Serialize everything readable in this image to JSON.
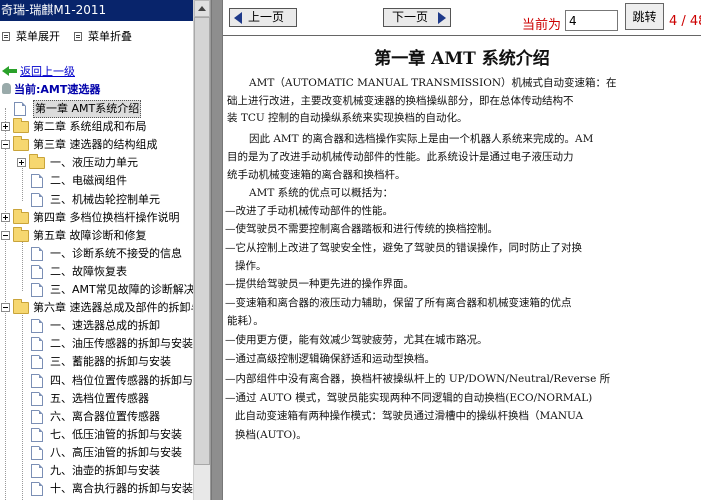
{
  "sidebar": {
    "title": "奇瑞-瑞麒M1-2011",
    "expand_label": "菜单展开",
    "collapse_label": "菜单折叠",
    "back_label": "返回上一级",
    "current_label": "当前:AMT速选器",
    "items": [
      {
        "label": "第一章 AMT系统介绍",
        "type": "doc",
        "level": 1,
        "selected": true
      },
      {
        "label": "第二章 系统组成和布局",
        "type": "folder",
        "level": 0
      },
      {
        "label": "第三章 速选器的结构组成",
        "type": "folder",
        "level": 0,
        "expanded": true
      },
      {
        "label": "一、液压动力单元",
        "type": "folder",
        "level": 1
      },
      {
        "label": "二、电磁阀组件",
        "type": "doc",
        "level": 2
      },
      {
        "label": "三、机械齿轮控制单元",
        "type": "doc",
        "level": 2
      },
      {
        "label": "第四章 多档位换档杆操作说明",
        "type": "folder",
        "level": 0
      },
      {
        "label": "第五章 故障诊断和修复",
        "type": "folder",
        "level": 0,
        "expanded": true
      },
      {
        "label": "一、诊断系统不接受的信息",
        "type": "doc",
        "level": 2
      },
      {
        "label": "二、故障恢复表",
        "type": "doc",
        "level": 2
      },
      {
        "label": "三、AMT常见故障的诊断解决",
        "type": "doc",
        "level": 2
      },
      {
        "label": "第六章 速选器总成及部件的拆卸与",
        "type": "folder",
        "level": 0,
        "expanded": true
      },
      {
        "label": "一、速选器总成的拆卸",
        "type": "doc",
        "level": 2
      },
      {
        "label": "二、油压传感器的拆卸与安装",
        "type": "doc",
        "level": 2
      },
      {
        "label": "三、蓄能器的拆卸与安装",
        "type": "doc",
        "level": 2
      },
      {
        "label": "四、档位位置传感器的拆卸与",
        "type": "doc",
        "level": 2
      },
      {
        "label": "五、选档位置传感器",
        "type": "doc",
        "level": 2
      },
      {
        "label": "六、离合器位置传感器",
        "type": "doc",
        "level": 2
      },
      {
        "label": "七、低压油管的拆卸与安装",
        "type": "doc",
        "level": 2
      },
      {
        "label": "八、高压油管的拆卸与安装",
        "type": "doc",
        "level": 2
      },
      {
        "label": "九、油壶的拆卸与安装",
        "type": "doc",
        "level": 2
      },
      {
        "label": "十、离合执行器的拆卸与安装",
        "type": "doc",
        "level": 2
      },
      {
        "label": "十一、油压泵继电器的拆卸与",
        "type": "doc",
        "level": 2
      }
    ]
  },
  "toolbar": {
    "prev_label": "上一页",
    "next_label": "下一页",
    "current_page_label": "当前为",
    "page_value": "4",
    "jump_label": "跳转",
    "page_count": "4 / 48"
  },
  "document": {
    "title": "第一章  AMT 系统介绍",
    "lines": [
      "AMT（AUTOMATIC MANUAL TRANSMISSION）机械式自动变速箱：在",
      "础上进行改进，主要改变机械变速器的换档操纵部分，即在总体传动结构不",
      "装 TCU 控制的自动操纵系统来实现换档的自动化。",
      "因此 AMT 的离合器和选档操作实际上是由一个机器人系统来完成的。AM",
      "目的是为了改进手动机械传动部件的性能。此系统设计是通过电子液压动力",
      "统手动机械变速箱的离合器和换档杆。",
      "AMT 系统的优点可以概括为：",
      "—改进了手动机械传动部件的性能。",
      "—使驾驶员不需要控制离合器踏板和进行传统的换档控制。",
      "—它从控制上改进了驾驶安全性，避免了驾驶员的错误操作，同时防止了对换",
      "操作。",
      "—提供给驾驶员一种更先进的操作界面。",
      "—变速箱和离合器的液压动力辅助，保留了所有离合器和机械变速箱的优点",
      "能耗）。",
      "—使用更方便，能有效减少驾驶疲劳，尤其在城市路况。",
      "—通过高级控制逻辑确保舒适和运动型换档。",
      "—内部组件中没有离合器，换档杆被操纵杆上的 UP/DOWN/Neutral/Reverse 所",
      "—通过 AUTO 模式，驾驶员能实现两种不同逻辑的自动换档(ECO/NORMAL)",
      "此自动变速箱有两种操作模式：驾驶员通过滑槽中的操纵杆换档（MANUA",
      "换档(AUTO)。"
    ]
  }
}
